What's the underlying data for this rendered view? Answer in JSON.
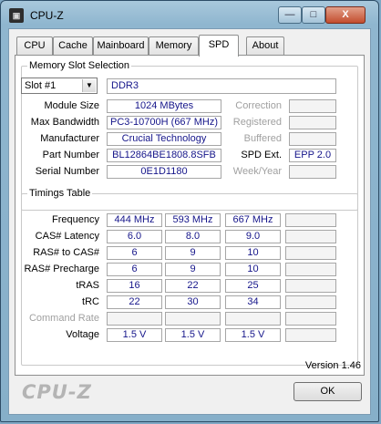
{
  "window": {
    "title": "CPU-Z",
    "icon": "cpu-z-app-icon",
    "minimize": "—",
    "maximize": "□",
    "close": "X"
  },
  "tabs": [
    "CPU",
    "Cache",
    "Mainboard",
    "Memory",
    "SPD",
    "About"
  ],
  "active_tab": "SPD",
  "slot_section": {
    "legend": "Memory Slot Selection",
    "slot_select": "Slot #1",
    "memory_type": "DDR3",
    "fields": {
      "module_size": {
        "label": "Module Size",
        "value": "1024 MBytes"
      },
      "max_bandwidth": {
        "label": "Max Bandwidth",
        "value": "PC3-10700H (667 MHz)"
      },
      "manufacturer": {
        "label": "Manufacturer",
        "value": "Crucial Technology"
      },
      "part_number": {
        "label": "Part Number",
        "value": "BL12864BE1808.8SFB"
      },
      "serial_number": {
        "label": "Serial Number",
        "value": "0E1D1180"
      }
    },
    "right": {
      "correction": {
        "label": "Correction",
        "value": ""
      },
      "registered": {
        "label": "Registered",
        "value": ""
      },
      "buffered": {
        "label": "Buffered",
        "value": ""
      },
      "spd_ext": {
        "label": "SPD Ext.",
        "value": "EPP 2.0"
      },
      "week_year": {
        "label": "Week/Year",
        "value": ""
      }
    }
  },
  "timings": {
    "legend": "Timings Table",
    "rows": [
      {
        "label": "Frequency",
        "values": [
          "444 MHz",
          "593 MHz",
          "667 MHz",
          ""
        ],
        "gray": false
      },
      {
        "label": "CAS# Latency",
        "values": [
          "6.0",
          "8.0",
          "9.0",
          ""
        ],
        "gray": false
      },
      {
        "label": "RAS# to CAS#",
        "values": [
          "6",
          "9",
          "10",
          ""
        ],
        "gray": false
      },
      {
        "label": "RAS# Precharge",
        "values": [
          "6",
          "9",
          "10",
          ""
        ],
        "gray": false
      },
      {
        "label": "tRAS",
        "values": [
          "16",
          "22",
          "25",
          ""
        ],
        "gray": false
      },
      {
        "label": "tRC",
        "values": [
          "22",
          "30",
          "34",
          ""
        ],
        "gray": false
      },
      {
        "label": "Command Rate",
        "values": [
          "",
          "",
          "",
          ""
        ],
        "gray": true
      },
      {
        "label": "Voltage",
        "values": [
          "1.5 V",
          "1.5 V",
          "1.5 V",
          ""
        ],
        "gray": false
      }
    ]
  },
  "footer": {
    "version": "Version 1.46",
    "brand": "CPU-Z",
    "ok": "OK"
  }
}
